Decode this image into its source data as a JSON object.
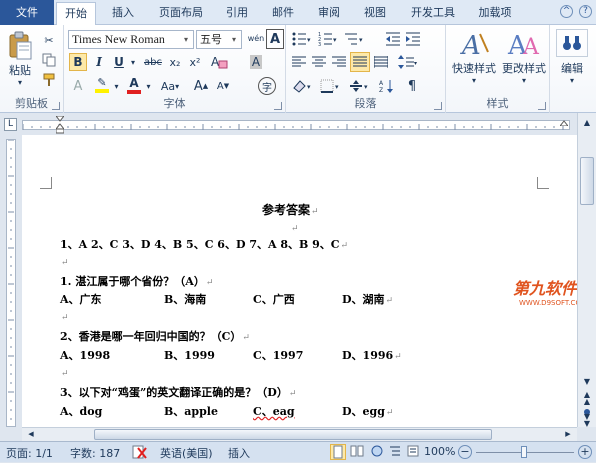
{
  "tabs": {
    "file": "文件",
    "items": [
      "开始",
      "插入",
      "页面布局",
      "引用",
      "邮件",
      "审阅",
      "视图",
      "开发工具",
      "加载项"
    ]
  },
  "clipboard": {
    "paste": "粘贴",
    "label": "剪贴板"
  },
  "font": {
    "name": "Times New Roman",
    "size": "五号",
    "bold": "B",
    "italic": "I",
    "underline": "U",
    "strike": "abc",
    "subscript": "x₂",
    "superscript": "x²",
    "font_color": "A",
    "change_case": "Aa",
    "grow": "A",
    "shrink": "A",
    "phonetic": "wén",
    "char_border": "A",
    "char_shade": "A",
    "enclosed": "字",
    "label": "字体"
  },
  "paragraph": {
    "label": "段落"
  },
  "styles": {
    "quick": "快速样式",
    "change": "更改样式",
    "label": "样式"
  },
  "editing": {
    "label": "编辑"
  },
  "document": {
    "title": "参考答案",
    "answers": "1、A   2、C   3、D   4、B   5、C   6、D   7、A   8、B   9、C",
    "q1": "1.   湛江属于哪个省份？（A）",
    "q1_options": [
      "A、广东",
      "B、海南",
      "C、广西",
      "D、湖南"
    ],
    "q2": "2、香港是哪一年回归中国的？（C）",
    "q2_options": [
      "A、1998",
      "B、1999",
      "C、1997",
      "D、1996"
    ],
    "q3": "3、以下对“鸡蛋”的英文翻译正确的是？（D）",
    "q3_options": [
      "A、dog",
      "B、apple",
      "C、eag",
      "D、egg"
    ]
  },
  "watermark": {
    "name": "第九软件网",
    "url": "WWW.D9SOFT.COM"
  },
  "status": {
    "page": "页面: 1/1",
    "words": "字数: 187",
    "language": "英语(美国)",
    "mode": "插入",
    "zoom": "100%"
  },
  "colors": {
    "file_tab": "#2b579a",
    "font_color_bar": "#e02020",
    "highlight_bar": "#fff200",
    "watermark": "#e0541f"
  }
}
